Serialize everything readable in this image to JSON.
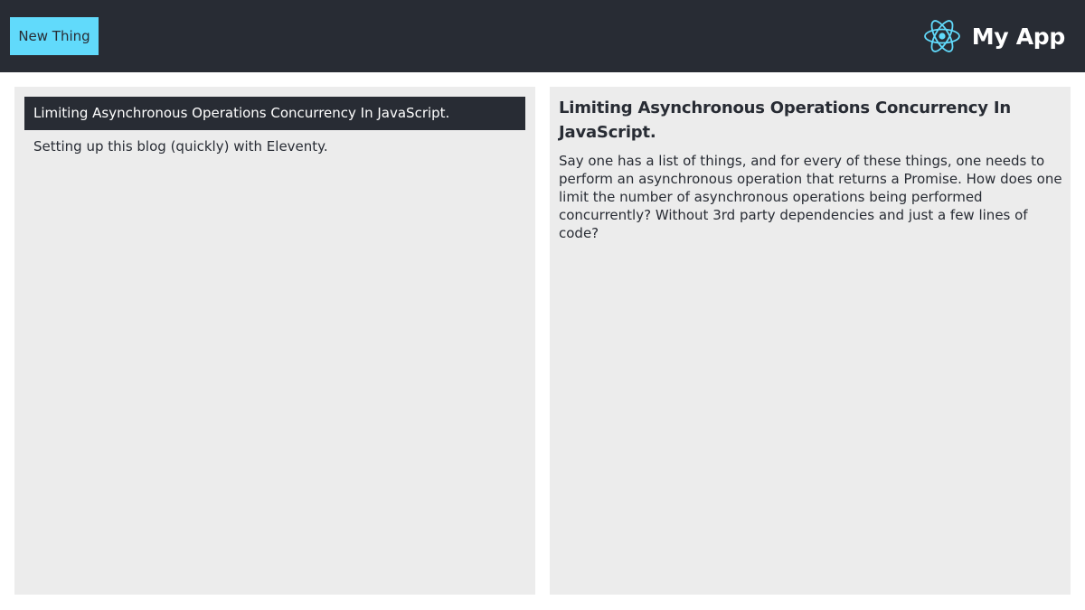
{
  "header": {
    "new_button_label": "New Thing",
    "app_title": "My App",
    "logo_icon": "react-atom-icon",
    "colors": {
      "bar": "#282c34",
      "accent": "#61dafb"
    }
  },
  "list": {
    "items": [
      {
        "label": "Limiting Asynchronous Operations Concurrency In JavaScript.",
        "selected": true
      },
      {
        "label": "Setting up this blog (quickly) with Eleventy.",
        "selected": false
      }
    ]
  },
  "detail": {
    "title": "Limiting Asynchronous Operations Concurrency In JavaScript.",
    "body": "Say one has a list of things, and for every of these things, one needs to perform an asynchronous operation that returns a Promise. How does one limit the number of asynchronous operations being performed concurrently? Without 3rd party dependencies and just a few lines of code?"
  }
}
